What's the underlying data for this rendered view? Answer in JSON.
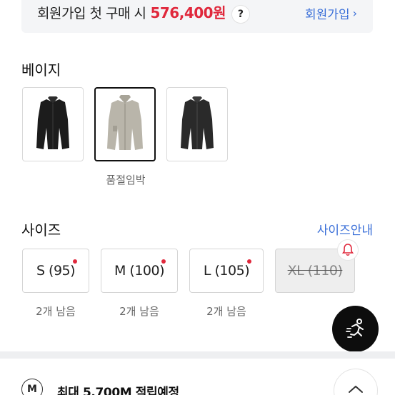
{
  "member_banner": {
    "text": "회원가입 첫 구매 시",
    "price": "576,400원",
    "help_label": "?",
    "signup_label": "회원가입",
    "signup_chevron": "›"
  },
  "color": {
    "title": "베이지",
    "swatches": [
      {
        "icon": "black-jacket-thumbnail",
        "tone": "#1c1c1c"
      },
      {
        "icon": "beige-jacket-thumbnail",
        "tone": "#b9b5aa",
        "selected": true
      },
      {
        "icon": "charcoal-jacket-thumbnail",
        "tone": "#2a2a2a"
      }
    ],
    "selected_note": "품절임박"
  },
  "size": {
    "title": "사이즈",
    "guide_label": "사이즈안내",
    "options": [
      {
        "label": "S (95)",
        "stock": "2개 남음",
        "low_stock": true
      },
      {
        "label": "M (100)",
        "stock": "2개 남음",
        "low_stock": true
      },
      {
        "label": "L (105)",
        "stock": "2개 남음",
        "low_stock": true
      },
      {
        "label": "XL (110)",
        "stock": "",
        "sold_out": true,
        "icon": "bell-icon"
      }
    ]
  },
  "fab": {
    "icon": "running-person-icon"
  },
  "points": {
    "icon_label": "M",
    "text": "최대 5,700M 적립예정",
    "expand_icon": "chevron-up-icon"
  },
  "colors": {
    "accent": "#3a6fd8",
    "price_red": "#e0283c",
    "dark": "#0d0d0d"
  }
}
